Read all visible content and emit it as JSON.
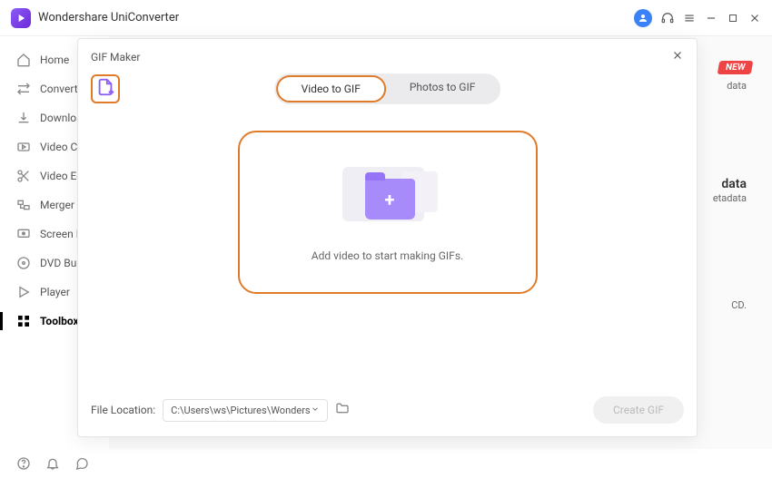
{
  "app_title": "Wondershare UniConverter",
  "sidebar": {
    "items": [
      {
        "label": "Home"
      },
      {
        "label": "Converter"
      },
      {
        "label": "Downloader"
      },
      {
        "label": "Video Compressor"
      },
      {
        "label": "Video Editor"
      },
      {
        "label": "Merger"
      },
      {
        "label": "Screen Recorder"
      },
      {
        "label": "DVD Burner"
      },
      {
        "label": "Player"
      },
      {
        "label": "Toolbox"
      }
    ]
  },
  "dialog": {
    "title": "GIF Maker",
    "tabs": {
      "video": "Video to GIF",
      "photos": "Photos to GIF"
    },
    "drop_text": "Add video to start making GIFs.",
    "file_location_label": "File Location:",
    "file_location_value": "C:\\Users\\ws\\Pictures\\Wonders",
    "create_label": "Create GIF"
  },
  "badge_new": "NEW",
  "ghost": {
    "data": "data",
    "etadata": "etadata",
    "cd": "CD."
  }
}
